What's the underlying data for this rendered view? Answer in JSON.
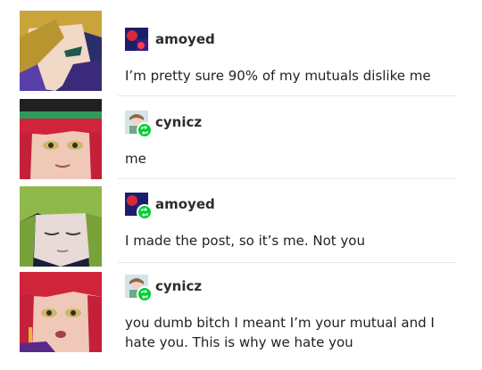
{
  "posts": [
    {
      "username": "amoyed",
      "text": "I’m pretty sure 90% of my mutuals dislike me",
      "avatar": "amoyed-avatar",
      "reblog": false,
      "portrait": "blonde-anime-character"
    },
    {
      "username": "cynicz",
      "text": "me",
      "avatar": "cynicz-avatar",
      "reblog": true,
      "portrait": "red-haired-anime-character-with-hat"
    },
    {
      "username": "amoyed",
      "text": "I made the post, so it’s me. Not you",
      "avatar": "amoyed-avatar",
      "reblog": true,
      "portrait": "green-haired-anime-character"
    },
    {
      "username": "cynicz",
      "text": "you dumb bitch I meant I’m your mutual and I hate you. This is why we hate you",
      "avatar": "cynicz-avatar",
      "reblog": true,
      "portrait": "red-haired-anime-character"
    }
  ],
  "colors": {
    "reblog_badge": "#00cf35",
    "divider": "#e8e8e8"
  }
}
